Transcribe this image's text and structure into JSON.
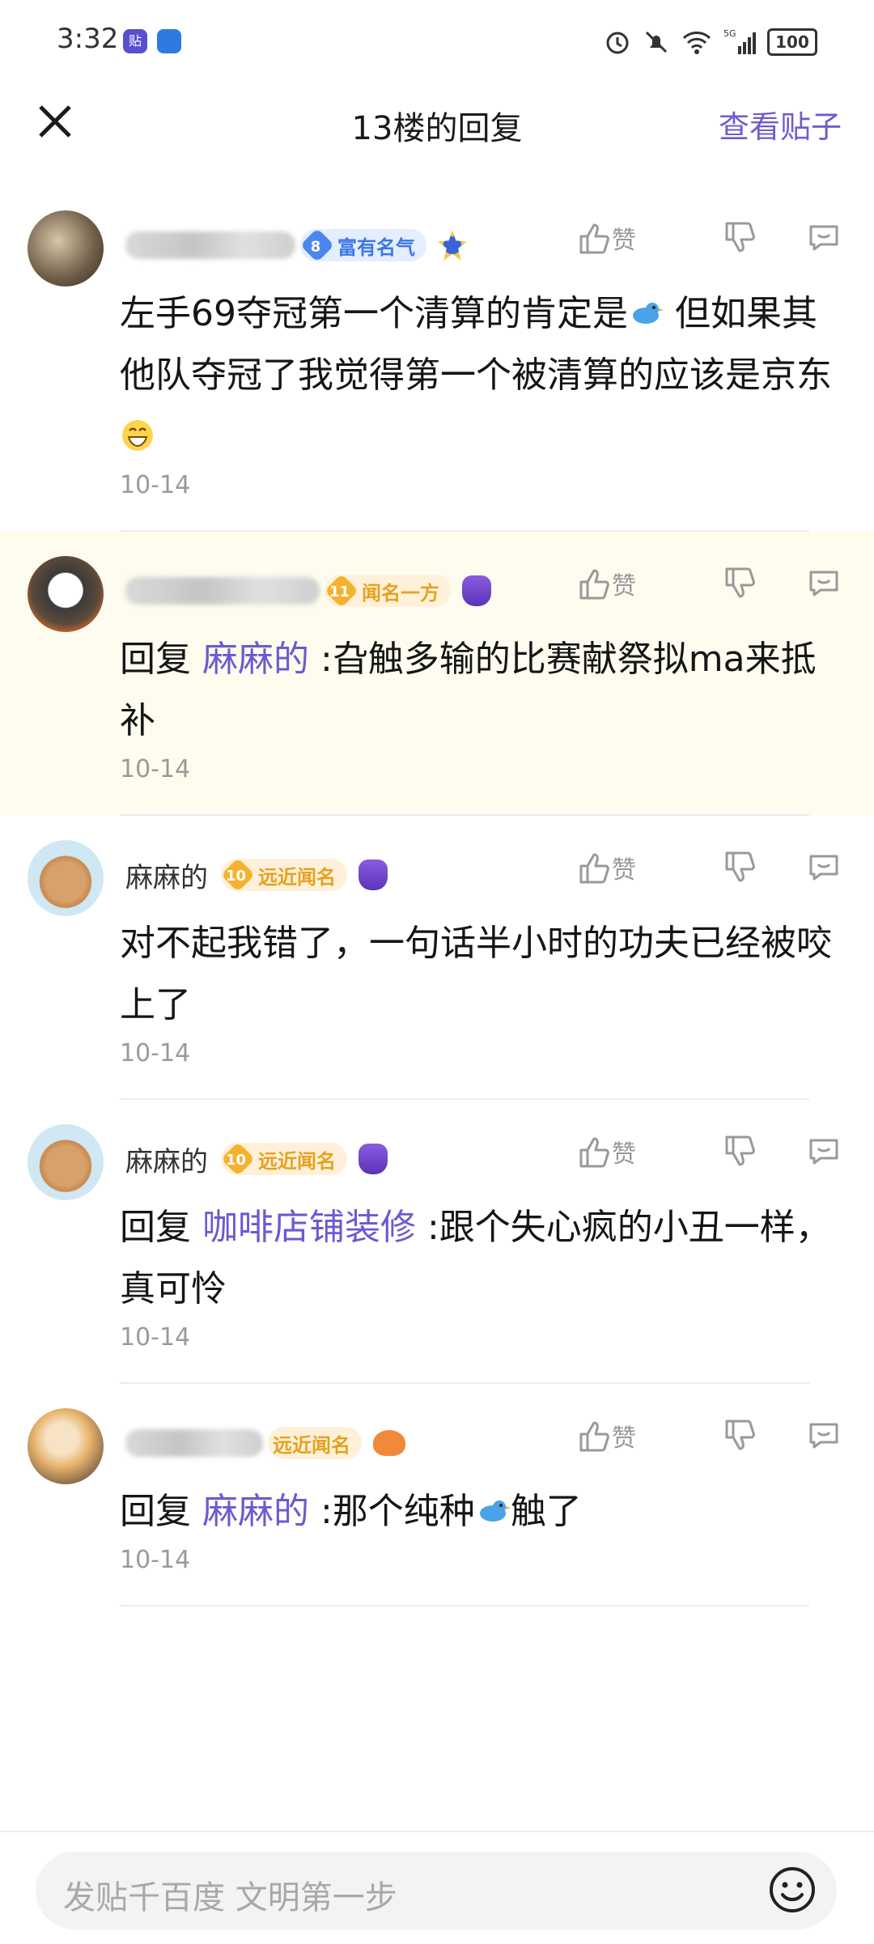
{
  "status": {
    "time": "3:32",
    "app_badge": "贴",
    "battery": "100"
  },
  "nav": {
    "title": "13楼的回复",
    "link": "查看贴子"
  },
  "replies": [
    {
      "name": "",
      "level": "8",
      "badge": "富有名气",
      "medal": "1",
      "text": "左手69夺冠第一个清算的肯定是",
      "text_after_bird": " 但如果其他队夺冠了我觉得第一个被清算的应该是京东 ",
      "date": "10-14",
      "like": "赞"
    },
    {
      "name": "",
      "level": "11",
      "badge": "闻名一方",
      "medal": "7",
      "prefix": "回复 ",
      "mention": "麻麻的",
      "text": " :旮触多输的比赛献祭拟ma来抵补",
      "date": "10-14",
      "like": "赞"
    },
    {
      "name": "麻麻的",
      "level": "10",
      "badge": "远近闻名",
      "medal": "1",
      "text": "对不起我错了，一句话半小时的功夫已经被咬上了",
      "date": "10-14",
      "like": "赞"
    },
    {
      "name": "麻麻的",
      "level": "10",
      "badge": "远近闻名",
      "medal": "1",
      "prefix": "回复 ",
      "mention": "咖啡店铺装修",
      "text": " :跟个失心疯的小丑一样，真可怜",
      "date": "10-14",
      "like": "赞"
    },
    {
      "name": "",
      "level": "",
      "badge": "远近闻名",
      "prefix": "回复 ",
      "mention": "麻麻的",
      "text": " :那个纯种",
      "text_after_bird": "触了",
      "date": "10-14",
      "like": "赞"
    }
  ],
  "composer": {
    "placeholder": "发贴千百度 文明第一步"
  }
}
